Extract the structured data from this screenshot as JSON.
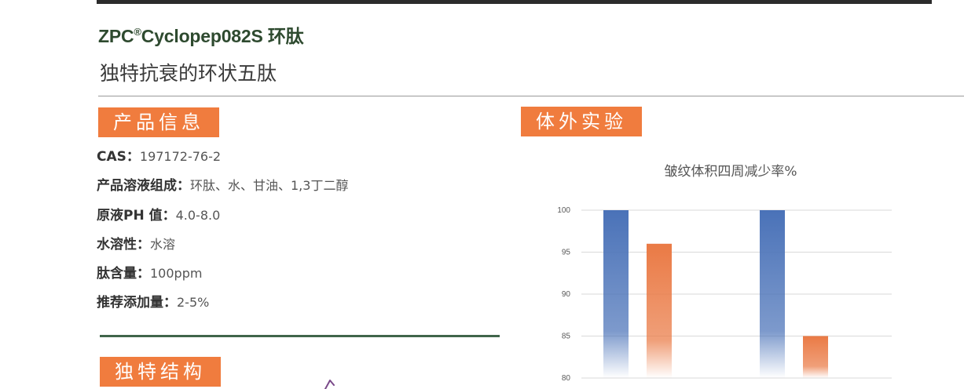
{
  "header": {
    "title_prefix": "ZPC",
    "title_mark": "®",
    "title_suffix": "Cyclopep082S 环肽",
    "subtitle": "独特抗衰的环状五肽"
  },
  "sections": {
    "product_info": "产品信息",
    "in_vitro": "体外实验",
    "structure": "独特结构"
  },
  "product_info": [
    {
      "label": "CAS：",
      "value": "197172-76-2"
    },
    {
      "label": "产品溶液组成：",
      "value": "环肽、水、甘油、1,3丁二醇"
    },
    {
      "label": "原液PH 值：",
      "value": "4.0-8.0"
    },
    {
      "label": "水溶性：",
      "value": "水溶"
    },
    {
      "label": "肽含量：",
      "value": "100ppm"
    },
    {
      "label": "推荐添加量：",
      "value": "2-5%"
    }
  ],
  "colors": {
    "accent": "#f07c3e",
    "title_green": "#2e4a2f",
    "rule_green": "#40654a",
    "bar_blue": "#4a72b8",
    "bar_orange": "#ea7a45"
  },
  "chart_data": {
    "type": "bar",
    "title": "皱纹体积四周减少率%",
    "categories": [
      "",
      ""
    ],
    "series": [
      {
        "values": [
          100,
          100
        ],
        "color": "#4a72b8"
      },
      {
        "values": [
          96,
          85
        ],
        "color": "#ea7a45"
      }
    ],
    "ylim": [
      80,
      100
    ],
    "yticks": [
      80,
      85,
      90,
      95,
      100
    ],
    "grid": true,
    "legend": "none"
  }
}
